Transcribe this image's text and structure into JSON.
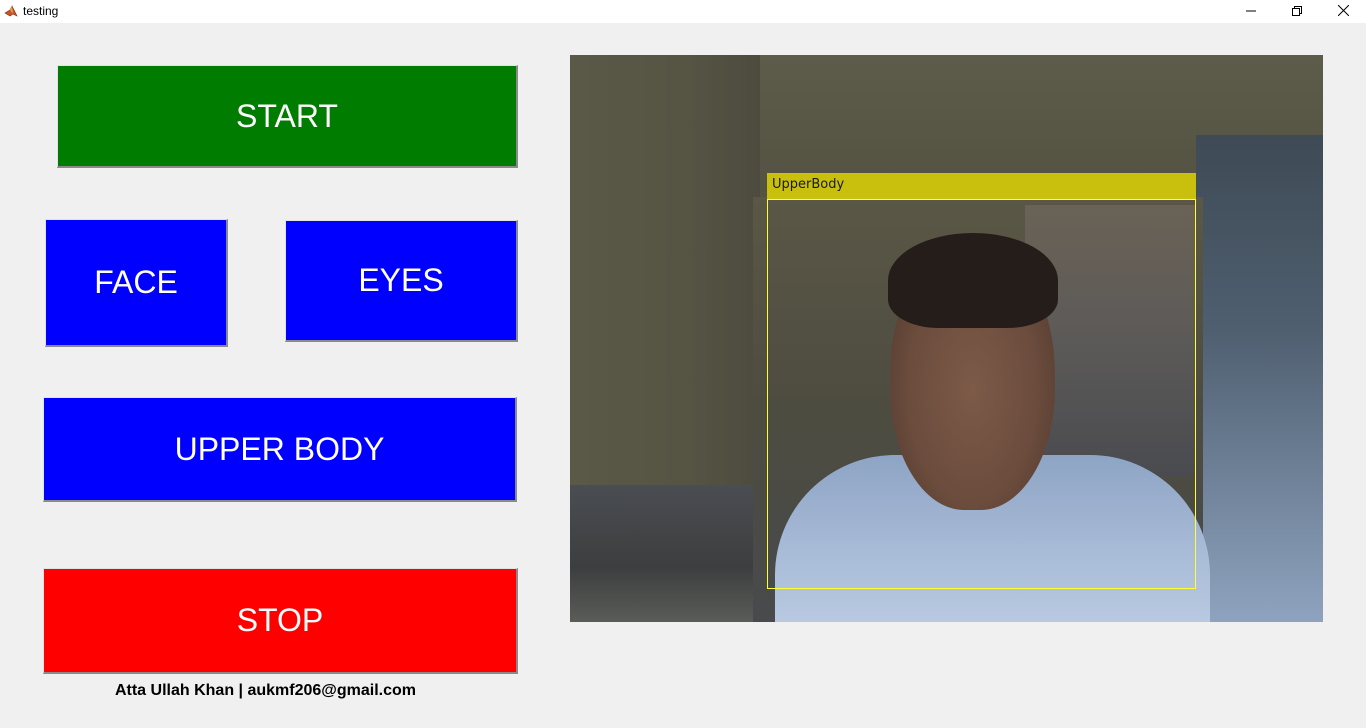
{
  "window": {
    "title": "testing",
    "icon": "matlab-icon",
    "controls": {
      "minimize": "minimize-icon",
      "maximize": "restore-icon",
      "close": "close-icon"
    }
  },
  "buttons": {
    "start": "START",
    "face": "FACE",
    "eyes": "EYES",
    "upper_body": "UPPER BODY",
    "stop": "STOP"
  },
  "colors": {
    "start": "#007d00",
    "detect": "#0000ff",
    "stop": "#ff0000",
    "bbox": "#ffff33"
  },
  "footer": {
    "credit": "Atta Ullah Khan | aukmf206@gmail.com"
  },
  "video": {
    "detection_label": "UpperBody"
  }
}
